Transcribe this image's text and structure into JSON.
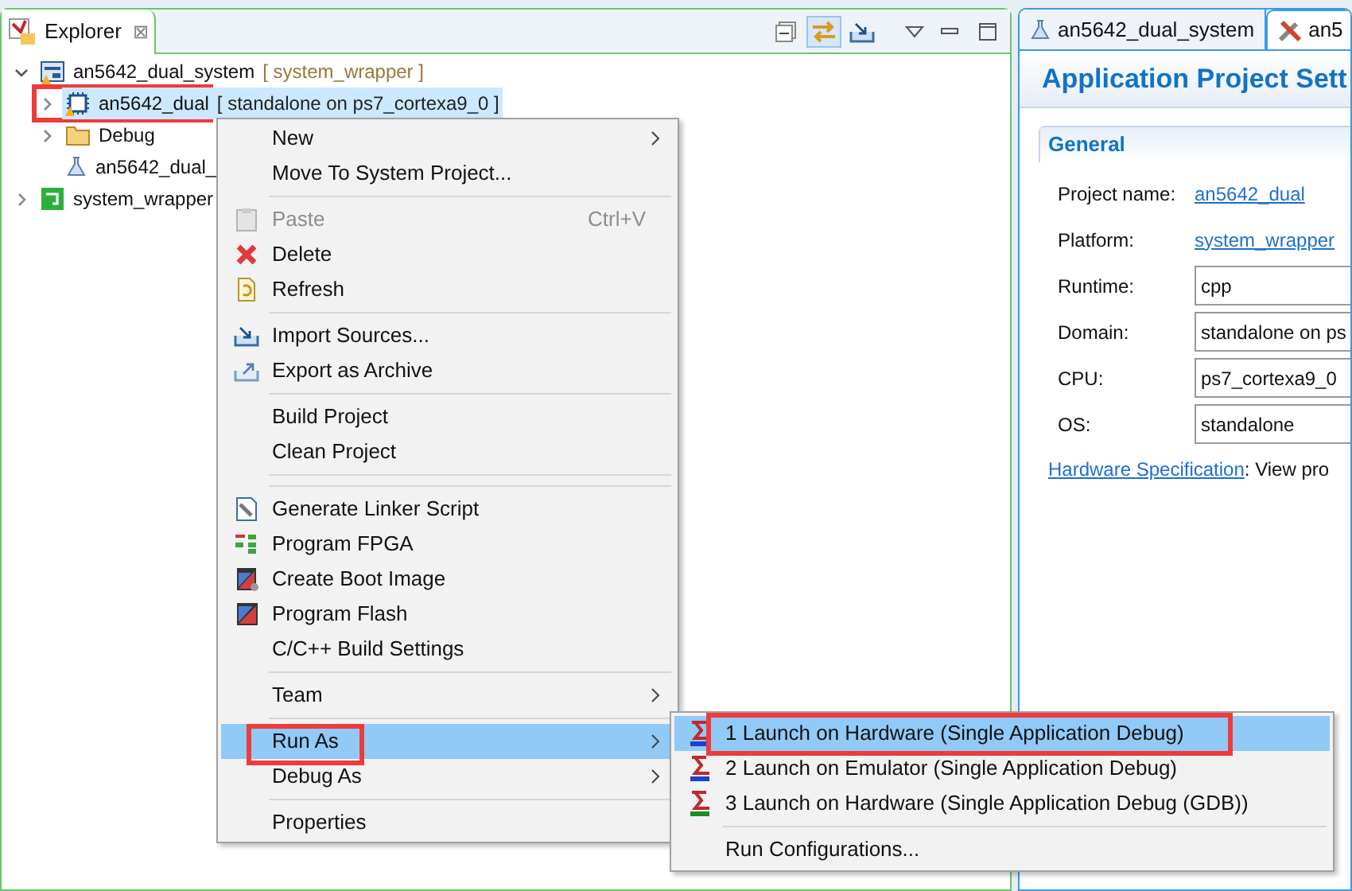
{
  "explorer": {
    "tab": {
      "title": "Explorer",
      "close": "⊠"
    },
    "toolbar": [
      {
        "kind": "collapse",
        "selected": false
      },
      {
        "kind": "link",
        "selected": true
      },
      {
        "kind": "import",
        "selected": false
      }
    ],
    "tree": [
      {
        "label": "an5642_dual_system",
        "suffix": "[ system_wrapper ]",
        "kind": "system",
        "expanded": true,
        "selected": false,
        "highlighted": false,
        "children": [
          {
            "label": "an5642_dual",
            "suffix": "[ standalone on ps7_cortexa9_0 ]",
            "kind": "app",
            "expanded": false,
            "selected": true,
            "highlighted": true
          },
          {
            "label": "Debug",
            "kind": "folder",
            "expanded": false,
            "selected": false,
            "highlighted": false
          },
          {
            "label": "an5642_dual_",
            "kind": "flask",
            "selected": false,
            "highlighted": false
          }
        ]
      },
      {
        "label": "system_wrapper",
        "kind": "platform",
        "expanded": false,
        "selected": false,
        "highlighted": false
      }
    ]
  },
  "editor": {
    "tabs": [
      {
        "label": "an5642_dual_system",
        "kind": "flask",
        "selected": false
      },
      {
        "label": "an5",
        "kind": "tools",
        "selected": true
      }
    ],
    "title": "Application Project Sett",
    "section": "General",
    "fields": [
      {
        "label": "Project name:",
        "value": "an5642_dual",
        "kind": "link"
      },
      {
        "label": "Platform:",
        "value": "system_wrapper",
        "kind": "link"
      },
      {
        "label": "Runtime:",
        "value": "cpp",
        "kind": "field"
      },
      {
        "label": "Domain:",
        "value": "standalone on ps",
        "kind": "field"
      },
      {
        "label": "CPU:",
        "value": "ps7_cortexa9_0",
        "kind": "field"
      },
      {
        "label": "OS:",
        "value": "standalone",
        "kind": "field"
      }
    ],
    "footer": {
      "link": "Hardware Specification",
      "text": ": View pro"
    }
  },
  "context_menu": [
    {
      "kind": "plain",
      "label": "New",
      "submenu": true,
      "disabled": false,
      "selected": false,
      "highlighted": false
    },
    {
      "kind": "plain",
      "label": "Move To System Project...",
      "submenu": false,
      "disabled": false,
      "selected": false,
      "highlighted": false
    },
    {
      "kind": "separator"
    },
    {
      "kind": "paste",
      "label": "Paste",
      "shortcut": "Ctrl+V",
      "submenu": false,
      "disabled": true,
      "selected": false,
      "highlighted": false
    },
    {
      "kind": "delete",
      "label": "Delete",
      "submenu": false,
      "disabled": false,
      "selected": false,
      "highlighted": false
    },
    {
      "kind": "refresh",
      "label": "Refresh",
      "submenu": false,
      "disabled": false,
      "selected": false,
      "highlighted": false
    },
    {
      "kind": "separator"
    },
    {
      "kind": "import",
      "label": "Import Sources...",
      "submenu": false,
      "disabled": false,
      "selected": false,
      "highlighted": false
    },
    {
      "kind": "export",
      "label": "Export as Archive",
      "submenu": false,
      "disabled": false,
      "selected": false,
      "highlighted": false
    },
    {
      "kind": "separator"
    },
    {
      "kind": "plain",
      "label": "Build Project",
      "submenu": false,
      "disabled": false,
      "selected": false,
      "highlighted": false
    },
    {
      "kind": "plain",
      "label": "Clean Project",
      "submenu": false,
      "disabled": false,
      "selected": false,
      "highlighted": false
    },
    {
      "kind": "separator"
    },
    {
      "kind": "separator"
    },
    {
      "kind": "linker",
      "label": "Generate Linker Script",
      "submenu": false,
      "disabled": false,
      "selected": false,
      "highlighted": false
    },
    {
      "kind": "fpga",
      "label": "Program FPGA",
      "submenu": false,
      "disabled": false,
      "selected": false,
      "highlighted": false
    },
    {
      "kind": "boot",
      "label": "Create Boot Image",
      "submenu": false,
      "disabled": false,
      "selected": false,
      "highlighted": false
    },
    {
      "kind": "flash",
      "label": "Program Flash",
      "submenu": false,
      "disabled": false,
      "selected": false,
      "highlighted": false
    },
    {
      "kind": "plain",
      "label": "C/C++ Build Settings",
      "submenu": false,
      "disabled": false,
      "selected": false,
      "highlighted": false
    },
    {
      "kind": "separator"
    },
    {
      "kind": "plain",
      "label": "Team",
      "submenu": true,
      "disabled": false,
      "selected": false,
      "highlighted": false
    },
    {
      "kind": "separator"
    },
    {
      "kind": "plain",
      "label": "Run As",
      "submenu": true,
      "disabled": false,
      "selected": true,
      "highlighted": true
    },
    {
      "kind": "plain",
      "label": "Debug As",
      "submenu": true,
      "disabled": false,
      "selected": false,
      "highlighted": false
    },
    {
      "kind": "separator"
    },
    {
      "kind": "plain",
      "label": "Properties",
      "submenu": false,
      "disabled": false,
      "selected": false,
      "highlighted": false
    }
  ],
  "submenu": [
    {
      "kind": "tcf",
      "label": "1 Launch on Hardware (Single Application Debug)",
      "selected": true,
      "highlighted": true
    },
    {
      "kind": "tcf",
      "label": "2 Launch on Emulator (Single Application Debug)",
      "selected": false,
      "highlighted": false
    },
    {
      "kind": "gdb",
      "label": "3 Launch on Hardware (Single Application Debug (GDB))",
      "selected": false,
      "highlighted": false
    },
    {
      "kind": "separator"
    },
    {
      "kind": "plain",
      "label": "Run Configurations...",
      "selected": false,
      "highlighted": false
    }
  ]
}
